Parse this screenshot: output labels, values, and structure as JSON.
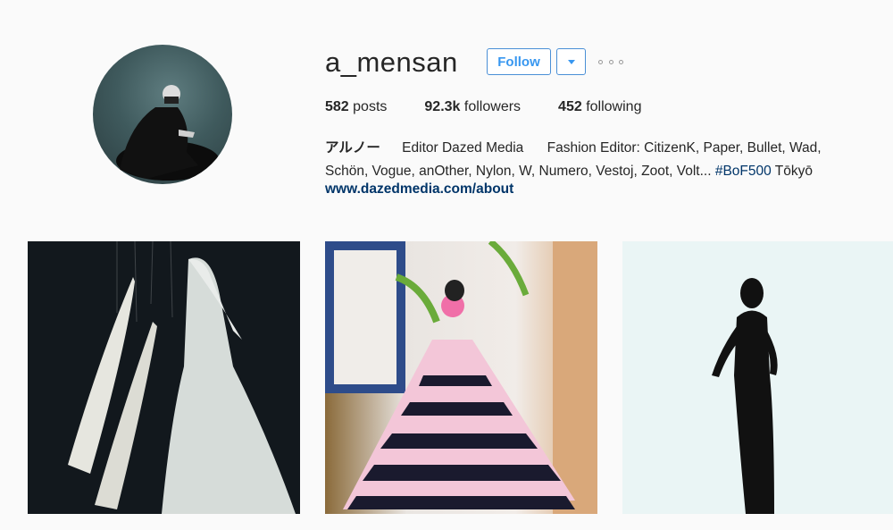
{
  "profile": {
    "username": "a_mensan",
    "follow_label": "Follow",
    "dropdown_icon": "caret-down-icon",
    "more_icon": "more-options-icon",
    "accent_color": "#3897f0"
  },
  "stats": {
    "posts_count": "582",
    "posts_label": "posts",
    "followers_count": "92.3k",
    "followers_label": "followers",
    "following_count": "452",
    "following_label": "following"
  },
  "bio": {
    "name": "アルノー",
    "part1": "Editor Dazed Media",
    "part2": "Fashion Editor: CitizenK, Paper, Bullet, Wad,",
    "part3": "Schön, Vogue, anOther, Nylon, W, Numero, Vestoj, Zoot, Volt...",
    "hashtag": "#BoF500",
    "location": "Tōkyō",
    "website": "www.dazedmedia.com/about"
  },
  "posts": [
    {
      "alt": "peacock-bride-photo"
    },
    {
      "alt": "striped-gown-photo"
    },
    {
      "alt": "silhouette-figure-photo"
    }
  ]
}
